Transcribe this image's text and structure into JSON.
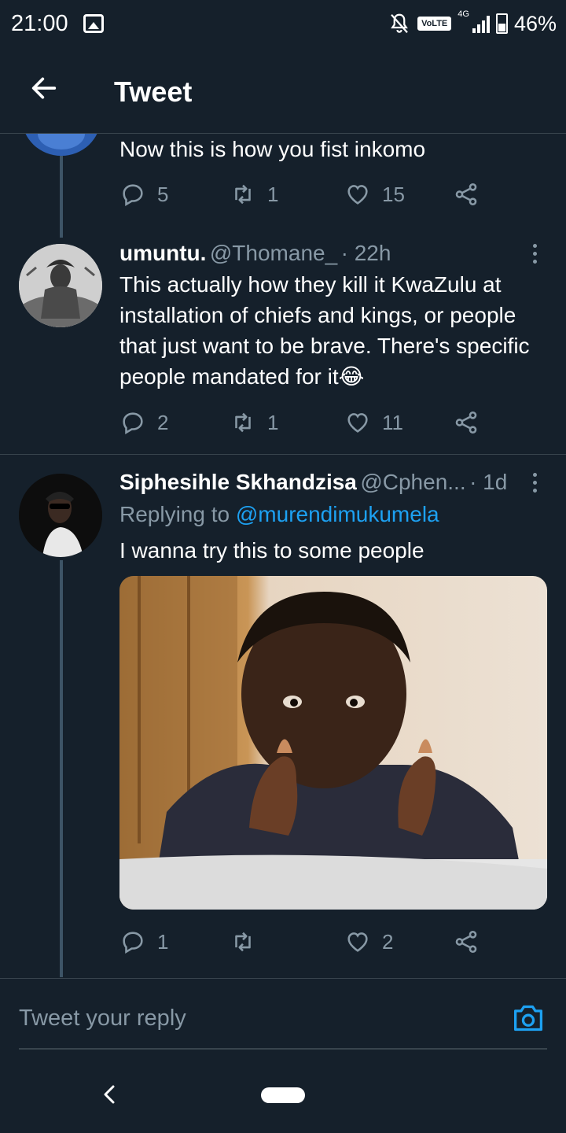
{
  "status_bar": {
    "time": "21:00",
    "network": "4G",
    "volte": "VoLTE",
    "battery": "46%",
    "battery_level": 0.46
  },
  "header": {
    "title": "Tweet"
  },
  "tweets": [
    {
      "text": "Now this is how you fist inkomo",
      "replies": "5",
      "retweets": "1",
      "likes": "15"
    },
    {
      "name": "umuntu.",
      "handle": "@Thomane_",
      "time": "· 22h",
      "text": "This actually how they kill it KwaZulu at installation of chiefs and kings, or people that just want to be brave. There's specific people mandated for it😂",
      "replies": "2",
      "retweets": "1",
      "likes": "11"
    },
    {
      "name": "Siphesihle Skhandzisa",
      "handle": "@Cphen...",
      "time": "· 1d",
      "replying_prefix": "Replying to",
      "replying_to": "@murendimukumela",
      "text": "I wanna try this to some people",
      "replies": "1",
      "retweets": "",
      "likes": "2"
    }
  ],
  "reply_bar": {
    "placeholder": "Tweet your reply"
  },
  "colors": {
    "background": "#15202b",
    "divider": "#38444d",
    "secondary_text": "#8899a6",
    "link": "#1da1f2"
  }
}
